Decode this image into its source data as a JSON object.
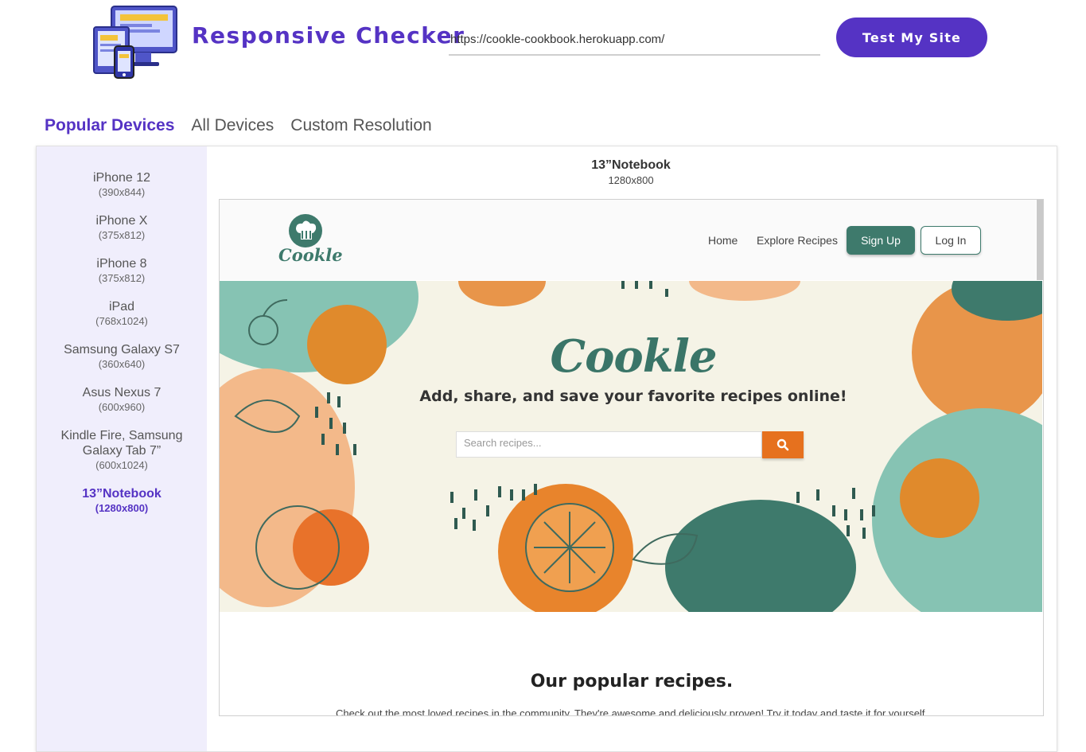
{
  "header": {
    "brand": "Responsive Checker",
    "url_value": "https://cookle-cookbook.herokuapp.com/",
    "test_button": "Test My Site"
  },
  "tabs": [
    {
      "label": "Popular Devices",
      "active": true
    },
    {
      "label": "All Devices",
      "active": false
    },
    {
      "label": "Custom Resolution",
      "active": false
    }
  ],
  "devices": [
    {
      "name": "iPhone 12",
      "size": "(390x844)"
    },
    {
      "name": "iPhone X",
      "size": "(375x812)"
    },
    {
      "name": "iPhone 8",
      "size": "(375x812)"
    },
    {
      "name": "iPad",
      "size": "(768x1024)"
    },
    {
      "name": "Samsung Galaxy S7",
      "size": "(360x640)"
    },
    {
      "name": "Asus Nexus 7",
      "size": "(600x960)"
    },
    {
      "name": "Kindle Fire, Samsung Galaxy Tab 7”",
      "size": "(600x1024)"
    },
    {
      "name": "13”Notebook",
      "size": "(1280x800)",
      "active": true
    }
  ],
  "preview": {
    "device_name": "13”Notebook",
    "device_size": "1280x800"
  },
  "site": {
    "logo_text": "Cookle",
    "nav": {
      "home": "Home",
      "explore": "Explore Recipes",
      "signup": "Sign Up",
      "login": "Log In"
    },
    "hero_title": "Cookle",
    "hero_subtitle": "Add, share, and save your favorite recipes online!",
    "search_placeholder": "Search recipes...",
    "section_title": "Our popular recipes.",
    "section_text": "Check out the most loved recipes in the community. They're awesome and deliciously proven! Try it today and taste it for yourself."
  },
  "colors": {
    "brand": "#5533c4",
    "sidebar_bg": "#f0eefc",
    "teal": "#3e7a6c",
    "orange": "#e6711e"
  }
}
